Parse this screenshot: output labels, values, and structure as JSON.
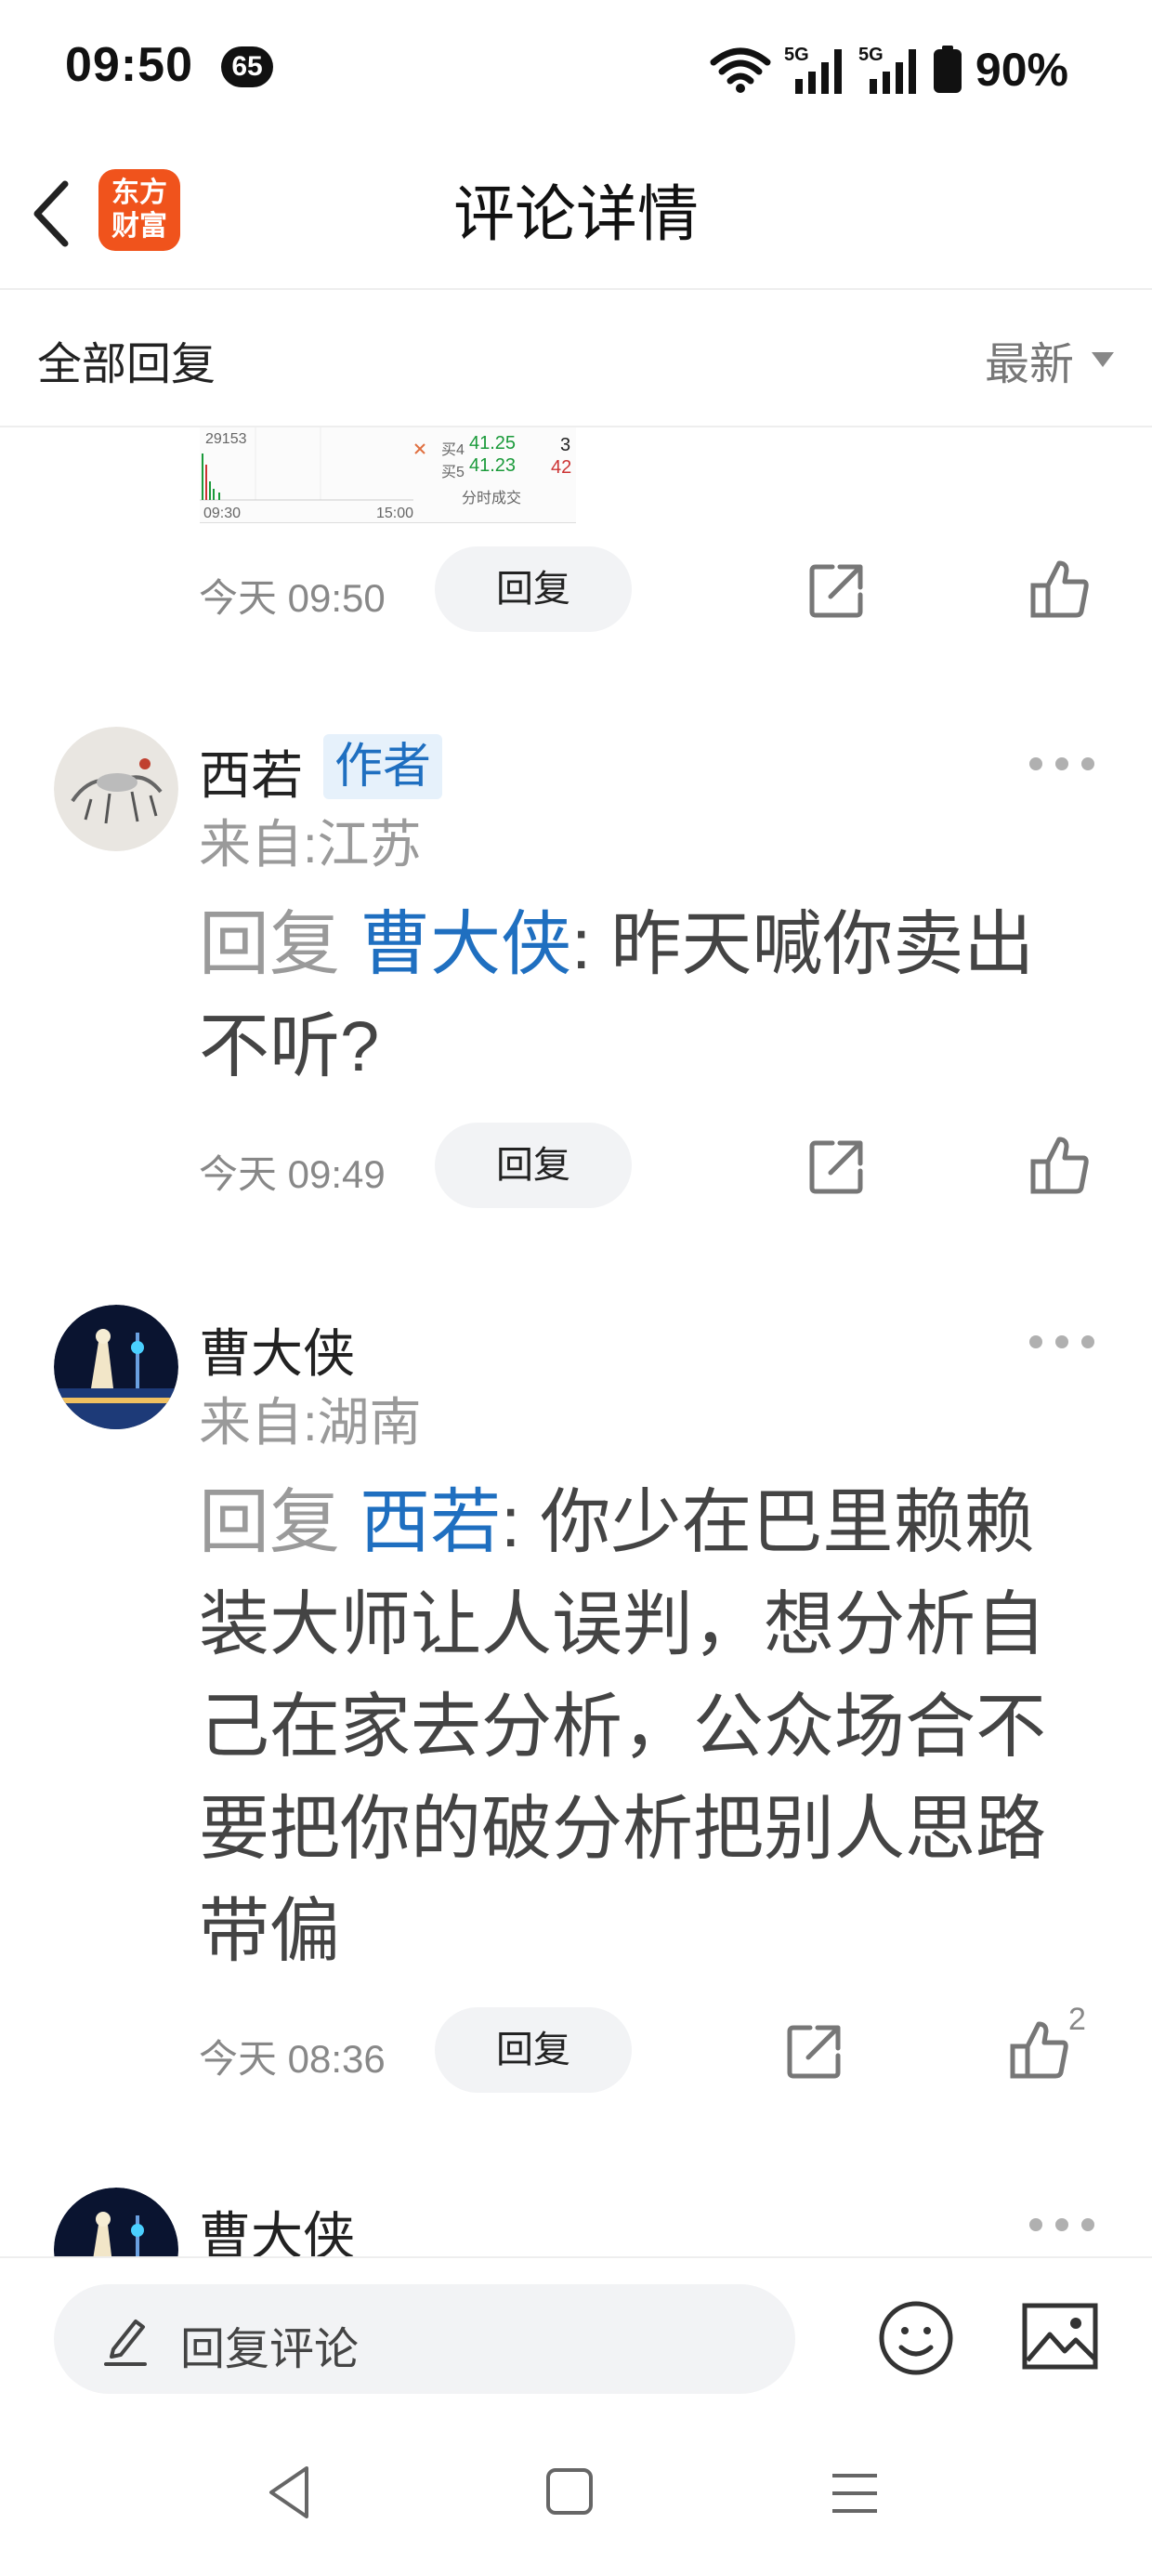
{
  "status_bar": {
    "time": "09:50",
    "notification_count": "65",
    "network_1": "5G",
    "network_2": "5G",
    "battery": "90%"
  },
  "header": {
    "title": "评论详情",
    "app_logo_text": "东方财富"
  },
  "filter": {
    "label": "全部回复",
    "sort_selected": "最新"
  },
  "thumbnail": {
    "chart_price": "29153",
    "time_start": "09:30",
    "time_end": "15:00",
    "rows": [
      {
        "label": "买4",
        "price": "41.25",
        "qty": "3"
      },
      {
        "label": "买5",
        "price": "41.23",
        "qty": "42"
      }
    ],
    "footer": "分时成交"
  },
  "first_actions": {
    "timestamp": "今天 09:50",
    "reply_label": "回复"
  },
  "comments": [
    {
      "username": "西若",
      "author_tag": "作者",
      "location": "来自:江苏",
      "reply_prefix": "回复",
      "mention": "曹大侠",
      "text": ": 昨天喊你卖出不听?",
      "timestamp": "今天 09:49",
      "reply_label": "回复",
      "likes": ""
    },
    {
      "username": "曹大侠",
      "location": "来自:湖南",
      "reply_prefix": "回复",
      "mention": "西若",
      "text": ": 你少在巴里赖赖装大师让人误判，想分析自己在家去分析，公众场合不要把你的破分析把别人思路带偏",
      "timestamp": "今天 08:36",
      "reply_label": "回复",
      "likes": "2"
    },
    {
      "username": "曹大侠"
    }
  ],
  "composer": {
    "placeholder": "回复评论"
  }
}
